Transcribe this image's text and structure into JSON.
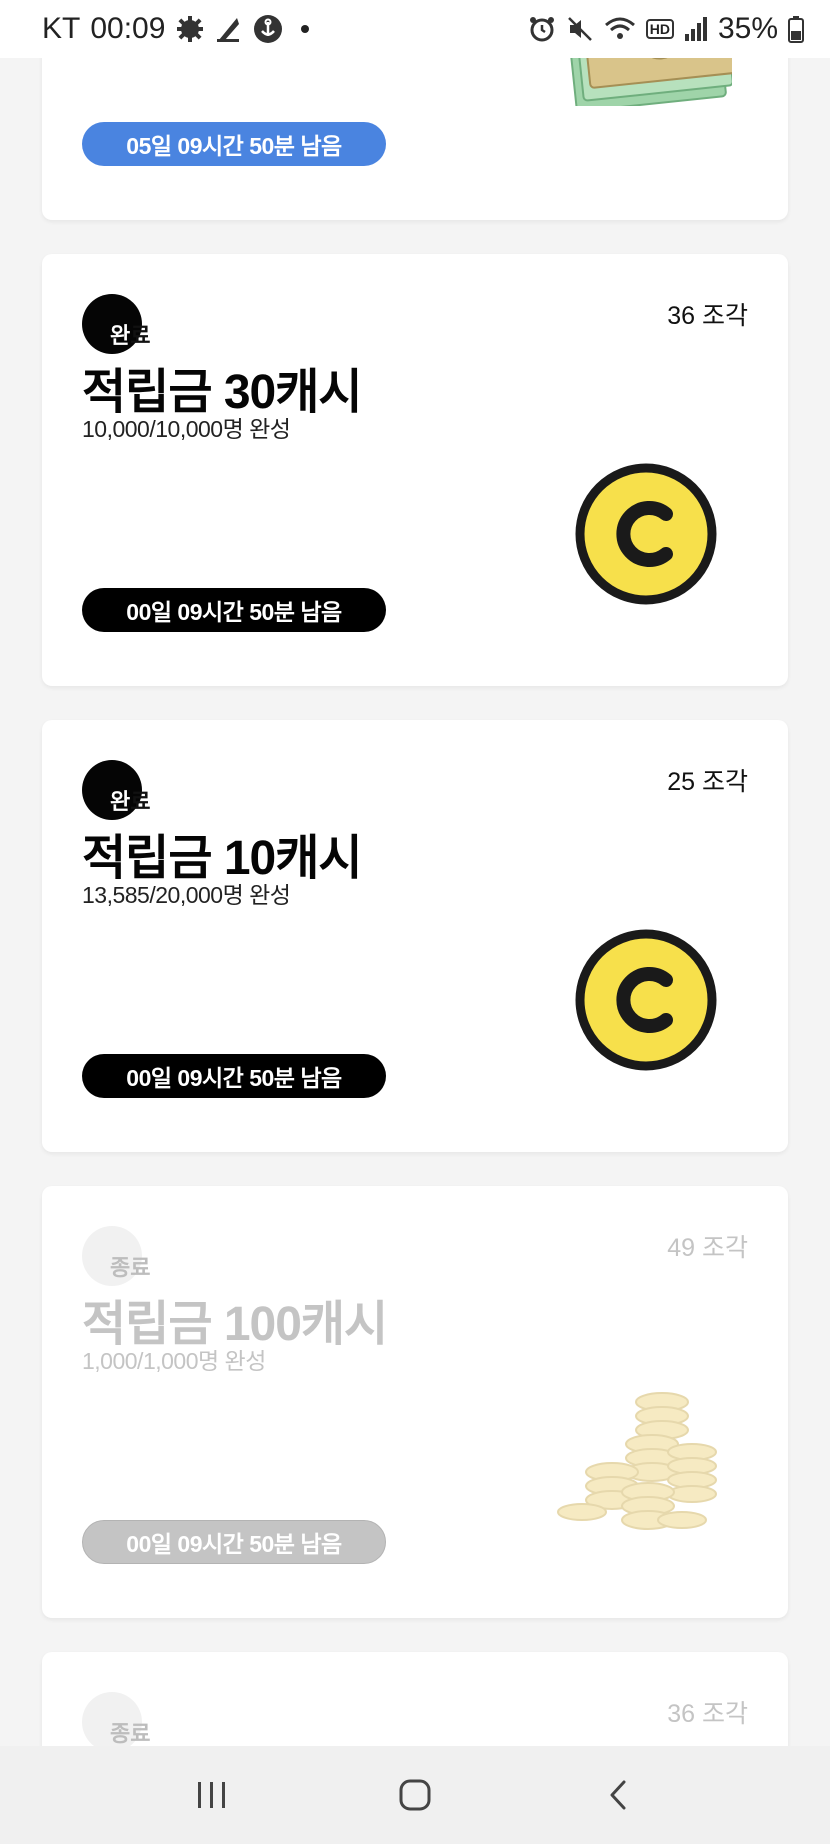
{
  "status_bar": {
    "carrier": "KT",
    "time": "00:09",
    "hd_label": "HD",
    "battery": "35%"
  },
  "cards": [
    {
      "timer": "05일 09시간 50분 남음",
      "image": "money-icon",
      "accent": "#4a84e0"
    },
    {
      "status": "완",
      "status_tail": "료",
      "pieces": "36 조각",
      "title": "적립금 30캐시",
      "progress": "10,000/10,000명 완성",
      "timer": "00일 09시간 50분 남음",
      "image": "cash-coin-icon"
    },
    {
      "status": "완",
      "status_tail": "료",
      "pieces": "25 조각",
      "title": "적립금 10캐시",
      "progress": "13,585/20,000명 완성",
      "timer": "00일 09시간 50분 남음",
      "image": "cash-coin-icon"
    },
    {
      "status": "종",
      "status_tail": "료",
      "pieces": "49 조각",
      "title": "적립금 100캐시",
      "progress": "1,000/1,000명 완성",
      "timer": "00일 09시간 50분 남음",
      "image": "coin-stack-icon"
    },
    {
      "status": "종",
      "status_tail": "료",
      "pieces": "36 조각"
    }
  ],
  "colors": {
    "coin_fill": "#f7e04b",
    "coin_outline": "#1a1a1a",
    "ended_text": "#c4c4c4"
  }
}
